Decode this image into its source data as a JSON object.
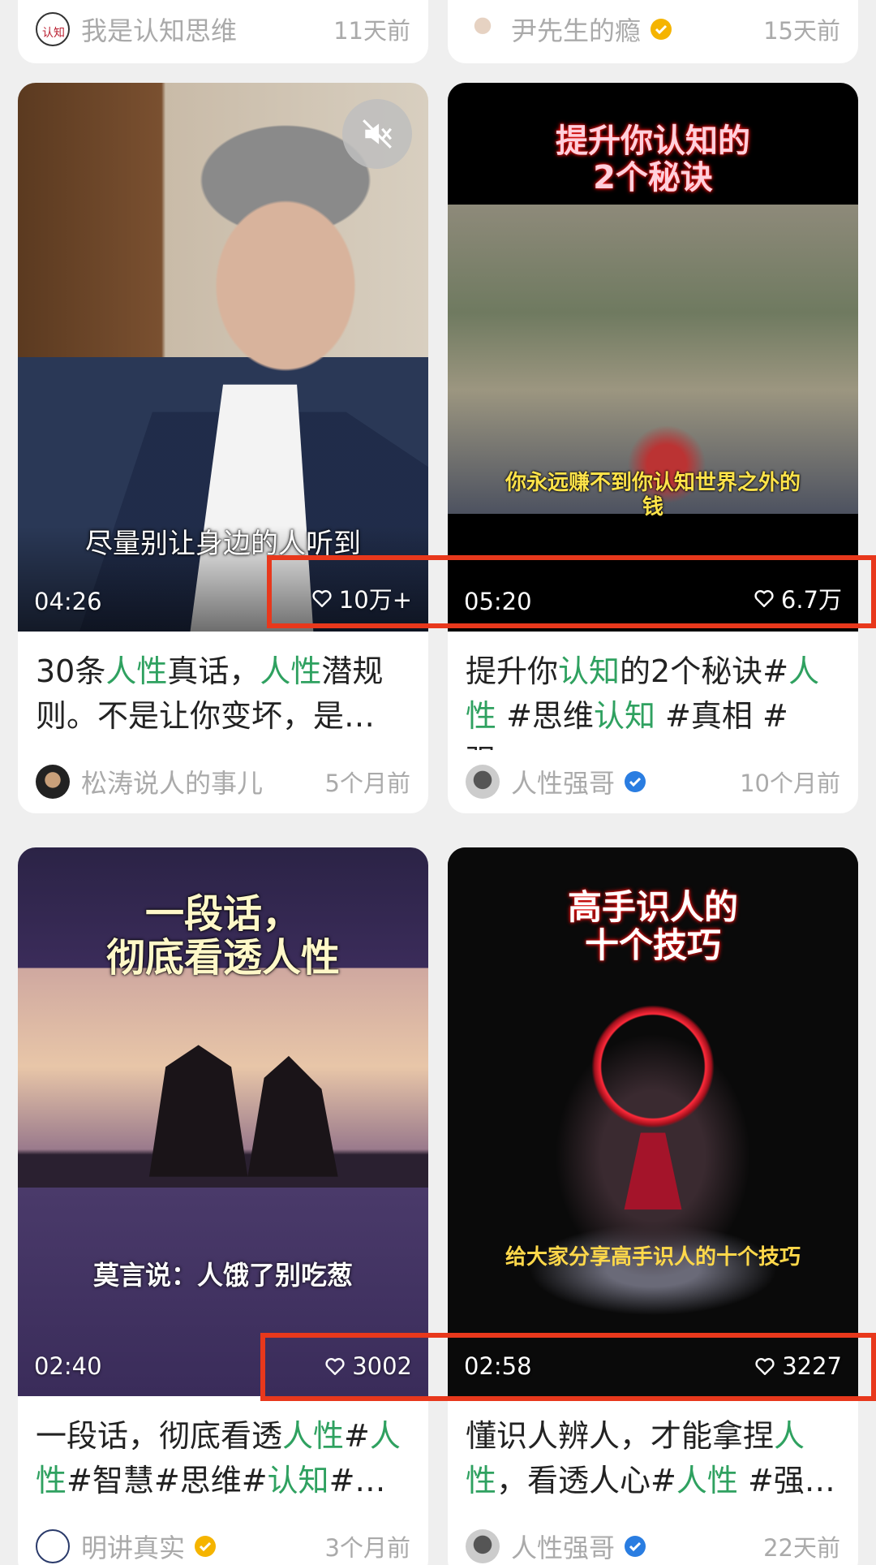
{
  "top_partial": [
    {
      "author": "我是认知思维",
      "time": "11天前",
      "verified": false
    },
    {
      "author": "尹先生的瘾",
      "time": "15天前",
      "verified": true
    }
  ],
  "cards": [
    {
      "overlay_title": "",
      "overlay_sub": "尽量别让身边的人听到",
      "duration": "04:26",
      "likes": "10万+",
      "caption_parts": [
        "30条",
        "人性",
        "真话，",
        "人性",
        "潜规则。不是让你变坏，是…"
      ],
      "author": "松涛说人的事儿",
      "time": "5个月前",
      "verified": false
    },
    {
      "overlay_title": "提升你认知的\n2个秘诀",
      "overlay_sub": "你永远赚不到你认知世界之外的\n钱",
      "duration": "05:20",
      "likes": "6.7万",
      "caption_parts": [
        "提升你",
        "认知",
        "的2个秘诀#",
        "人性",
        " #思维",
        "认知",
        " #真相 #强…"
      ],
      "author": "人性强哥",
      "time": "10个月前",
      "verified": true
    },
    {
      "overlay_title": "一段话，\n彻底看透人性",
      "overlay_sub": "莫言说：人饿了别吃葱",
      "duration": "02:40",
      "likes": "3002",
      "caption_parts": [
        "一段话，彻底看透",
        "人性",
        "#",
        "人性",
        "#智慧#思维#",
        "认知",
        "#…"
      ],
      "author": "明讲真实",
      "time": "3个月前",
      "verified": true
    },
    {
      "overlay_title": "高手识人的\n十个技巧",
      "overlay_sub": "给大家分享高手识人的十个技巧",
      "duration": "02:58",
      "likes": "3227",
      "caption_parts": [
        "懂识人辨人，才能拿捏",
        "人性",
        "，看透人心#",
        "人性",
        " #强…"
      ],
      "author": "人性强哥",
      "time": "22天前",
      "verified": true
    }
  ],
  "colors": {
    "highlight": "#2fa160",
    "annotation_box": "#e8381c",
    "verified_gold": "#f5b400",
    "verified_blue": "#2a7de1"
  },
  "icons": [
    "heart-outline-icon",
    "verified-badge-icon",
    "mute-icon"
  ]
}
